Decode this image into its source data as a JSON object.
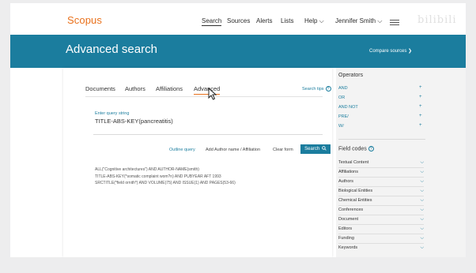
{
  "header": {
    "logo": "Scopus",
    "nav": [
      {
        "label": "Search"
      },
      {
        "label": "Sources"
      },
      {
        "label": "Alerts"
      },
      {
        "label": "Lists"
      },
      {
        "label": "Help ⌵"
      },
      {
        "label": "Jennifer Smith ⌵"
      }
    ],
    "watermark": "bilibili"
  },
  "band": {
    "title": "Advanced search",
    "compare": "Compare sources ❯"
  },
  "tabs": [
    "Documents",
    "Authors",
    "Affiliations",
    "Advanced"
  ],
  "search_tips": "Search tips",
  "query": {
    "label": "Enter query string",
    "value": "TITLE-ABS-KEY(pancreatitis)"
  },
  "actions": {
    "outline": "Outline query",
    "add_author": "Add Author name / Affiliation",
    "clear": "Clear form",
    "search": "Search"
  },
  "examples": [
    "ALL(\"Cognitive architectures\") AND AUTHOR-NAME(smith)",
    "TITLE-ABS-KEY(*somatic complaint wom?n) AND PUBYEAR AFT 1993",
    "SRCTITLE(*field ornith*) AND VOLUME(75) AND ISSUE(1) AND PAGES(53-66)"
  ],
  "operators": {
    "title": "Operators",
    "items": [
      "AND",
      "OR",
      "AND NOT",
      "PRE/",
      "W/"
    ]
  },
  "field_codes": {
    "title": "Field codes",
    "items": [
      "Textual Content",
      "Affiliations",
      "Authors",
      "Biological Entities",
      "Chemical Entities",
      "Conferences",
      "Document",
      "Editors",
      "Funding",
      "Keywords"
    ]
  },
  "colors": {
    "brand_orange": "#e9711c",
    "teal": "#1b7d9e"
  }
}
